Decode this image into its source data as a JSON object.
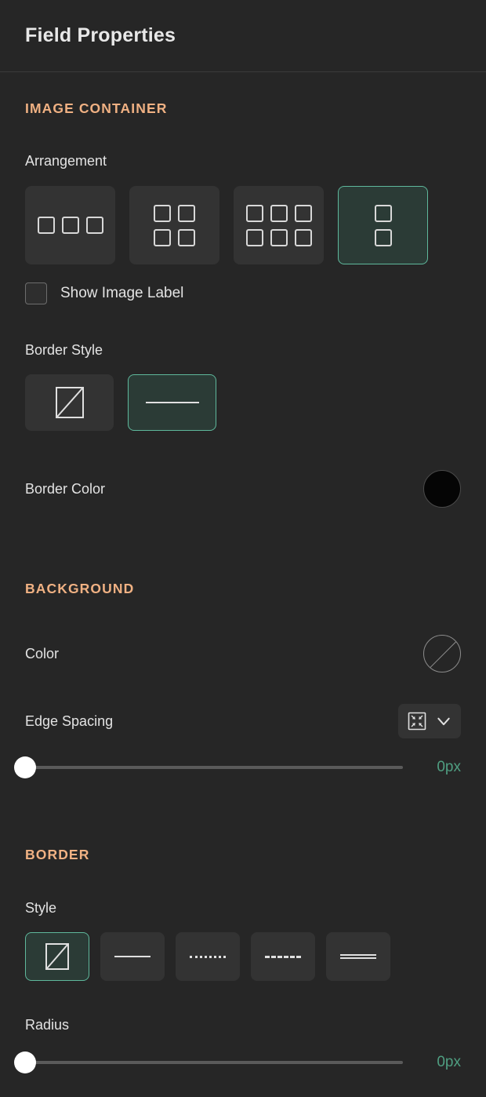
{
  "header": {
    "title": "Field Properties"
  },
  "sections": {
    "image_container": {
      "heading": "IMAGE CONTAINER",
      "arrangement": {
        "label": "Arrangement",
        "options": [
          {
            "name": "row-of-three",
            "icon": "grid-1x3-icon",
            "cols": 3,
            "count": 3,
            "selected": false
          },
          {
            "name": "grid-two-by-two",
            "icon": "grid-2x2-icon",
            "cols": 2,
            "count": 4,
            "selected": false
          },
          {
            "name": "grid-three-by-two",
            "icon": "grid-3x2-icon",
            "cols": 3,
            "count": 6,
            "selected": false
          },
          {
            "name": "column-of-two",
            "icon": "grid-2x1-icon",
            "cols": 1,
            "count": 2,
            "selected": true
          }
        ],
        "selected_index": 3
      },
      "show_image_label": {
        "label": "Show Image Label",
        "checked": false
      },
      "border_style": {
        "label": "Border Style",
        "options": [
          {
            "name": "none",
            "icon": "no-border-icon",
            "selected": false
          },
          {
            "name": "solid",
            "icon": "solid-line-icon",
            "selected": true
          }
        ],
        "selected_index": 1
      },
      "border_color": {
        "label": "Border Color",
        "value": "#050505",
        "swatch_type": "solid"
      }
    },
    "background": {
      "heading": "BACKGROUND",
      "color": {
        "label": "Color",
        "value": "none",
        "swatch_type": "none"
      },
      "edge_spacing": {
        "label": "Edge Spacing",
        "dropdown_icon": "inset-arrows-icon",
        "chevron_icon": "chevron-down-icon",
        "slider_value": "0px",
        "slider_percent": 0
      }
    },
    "border": {
      "heading": "BORDER",
      "style": {
        "label": "Style",
        "options": [
          {
            "name": "none",
            "icon": "no-border-icon",
            "selected": true
          },
          {
            "name": "solid",
            "icon": "solid-line-icon",
            "selected": false
          },
          {
            "name": "dotted",
            "icon": "dotted-line-icon",
            "selected": false
          },
          {
            "name": "dashed",
            "icon": "dashed-line-icon",
            "selected": false
          },
          {
            "name": "double",
            "icon": "double-line-icon",
            "selected": false
          }
        ],
        "selected_index": 0
      },
      "radius": {
        "label": "Radius",
        "slider_value": "0px",
        "slider_percent": 0
      }
    }
  },
  "colors": {
    "accent_selected_border": "#5fb89c",
    "accent_selected_fill": "#2b3b36",
    "section_heading": "#f0b183",
    "value_text": "#4f9e81",
    "panel_background": "#262626",
    "button_background": "#333333"
  }
}
